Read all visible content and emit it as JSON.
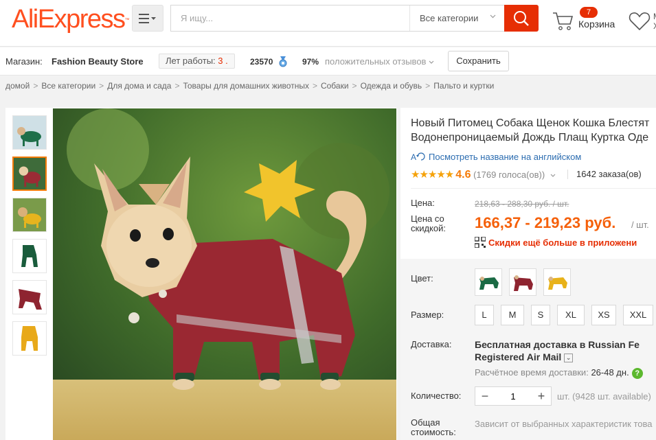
{
  "header": {
    "logo": "AliExpress",
    "logo_tm": "™",
    "search_placeholder": "Я ищу...",
    "search_category": "Все категории",
    "cart_count": "7",
    "cart_label": "Корзина",
    "wish_text_1": "М",
    "wish_text_2": "Х",
    "accent_color": "#e62e04"
  },
  "store": {
    "label": "Магазин:",
    "name": "Fashion Beauty Store",
    "years_label": "Лет работы:",
    "years_value": "3 .",
    "feedback_score": "23570",
    "positive_pct": "97%",
    "positive_label": "положительных отзывов",
    "save_label": "Сохранить"
  },
  "breadcrumbs": [
    "домой",
    "Все категории",
    "Для дома и сада",
    "Товары для домашних животных",
    "Собаки",
    "Одежда и обувь",
    "Пальто и куртки"
  ],
  "product": {
    "title_line1": "Новый Питомец Собака Щенок Кошка Блестят",
    "title_line2": "Водонепроницаемый Дождь Плащ Куртка Оде",
    "translate_link": "Посмотреть название на английском",
    "translate_icon_text": "A",
    "stars": "★★★★★",
    "rating": "4.6",
    "votes": "(1769 голоса(ов))",
    "orders": "1642 заказа(ов)",
    "price_label": "Цена:",
    "old_price": "218,63 - 288,30 руб. / шт.",
    "discount_label_1": "Цена со",
    "discount_label_2": "скидкой:",
    "new_price": "166,37 - 219,23 руб.",
    "per_unit": "/ шт.",
    "app_promo": "Скидки ещё больше в приложени"
  },
  "options": {
    "color_label": "Цвет:",
    "colors": [
      "green",
      "red",
      "yellow"
    ],
    "size_label": "Размер:",
    "sizes": [
      "L",
      "M",
      "S",
      "XL",
      "XS",
      "XXL"
    ],
    "shipping_label": "Доставка:",
    "shipping_line1": "Бесплатная доставка в Russian Fe",
    "shipping_line2": "Registered Air Mail",
    "ship_time_label": "Расчётное время доставки:",
    "ship_time_value": "26-48 дн.",
    "qty_label": "Количество:",
    "qty_value": "1",
    "available": "шт. (9428 шт. available)",
    "total_label_1": "Общая",
    "total_label_2": "стоимость:",
    "total_value": "Зависит от выбранных характеристик това"
  }
}
